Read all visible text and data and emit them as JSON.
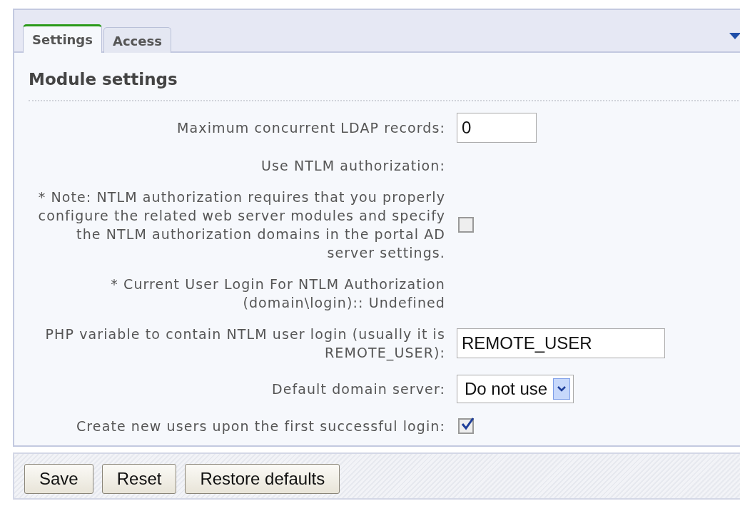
{
  "tabs": [
    {
      "label": "Settings",
      "selected": true
    },
    {
      "label": "Access",
      "selected": false
    }
  ],
  "heading": "Module settings",
  "fields": [
    {
      "kind": "text",
      "label": "Maximum concurrent LDAP records:",
      "value": "0"
    },
    {
      "kind": "label",
      "label": "Use NTLM authorization:"
    },
    {
      "kind": "checkbox",
      "label": "* Note: NTLM authorization requires that you properly configure the related web server modules and specify the NTLM authorization domains in the portal AD server settings.",
      "checked": false
    },
    {
      "kind": "label",
      "label": "* Current User Login For NTLM Authorization (domain\\login):: Undefined"
    },
    {
      "kind": "text",
      "label": "PHP variable to contain NTLM user login (usually it is REMOTE_USER):",
      "value": "REMOTE_USER"
    },
    {
      "kind": "select",
      "label": "Default domain server:",
      "value": "Do not use"
    },
    {
      "kind": "checkbox",
      "label": "Create new users upon the first successful login:",
      "checked": true
    }
  ],
  "buttons": [
    "Save",
    "Reset",
    "Restore defaults"
  ]
}
